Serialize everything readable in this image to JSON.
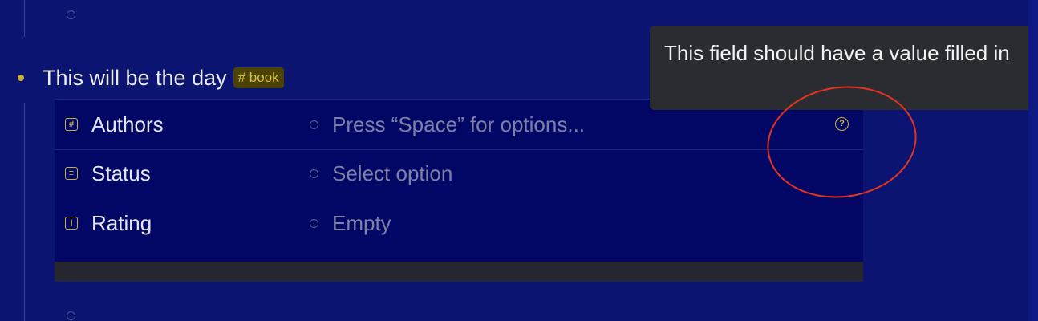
{
  "node": {
    "title": "This will be the day",
    "tag": "# book"
  },
  "fields": [
    {
      "icon": "number-field-icon",
      "icon_glyph": "#",
      "label": "Authors",
      "value": "Press “Space” for options..."
    },
    {
      "icon": "list-field-icon",
      "icon_glyph": "≡",
      "label": "Status",
      "value": "Select option"
    },
    {
      "icon": "text-field-icon",
      "icon_glyph": "I",
      "label": "Rating",
      "value": "Empty"
    }
  ],
  "tooltip": {
    "text": "This field should have a value filled in"
  },
  "warning_icon": {
    "glyph": "?"
  },
  "colors": {
    "background": "#0b1470",
    "accent": "#c9b23a",
    "annotation": "#e4341f",
    "tooltip_bg": "#2a2c32"
  }
}
